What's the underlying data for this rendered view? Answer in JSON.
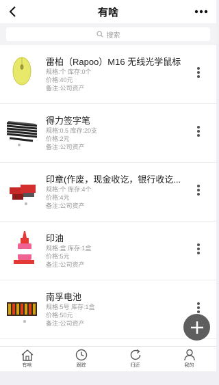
{
  "header": {
    "title": "有啥"
  },
  "search": {
    "placeholder": "搜索"
  },
  "items": [
    {
      "name": "雷柏（Rapoo）M16 无线光学鼠标",
      "spec": "规格:个 库存:0个",
      "price": "价格:40元",
      "note": "备注:公司资产"
    },
    {
      "name": "得力签字笔",
      "spec": "规格:0.5 库存:20支",
      "price": "价格:2元",
      "note": "备注:公司资产"
    },
    {
      "name": "印章(作废，现金收讫，银行收讫...",
      "spec": "规格:个 库存:4个",
      "price": "价格:4元",
      "note": "备注:公司资产"
    },
    {
      "name": "印油",
      "spec": "规格:盒 库存:1盒",
      "price": "价格:5元",
      "note": "备注:公司资产"
    },
    {
      "name": "南孚电池",
      "spec": "规格:5号 库存:1盒",
      "price": "价格:50元",
      "note": "备注:公司资产"
    }
  ],
  "tabs": [
    {
      "label": "有啥",
      "icon": "home-icon"
    },
    {
      "label": "跟踪",
      "icon": "clock-icon"
    },
    {
      "label": "归还",
      "icon": "refresh-icon"
    },
    {
      "label": "我的",
      "icon": "user-icon"
    }
  ]
}
